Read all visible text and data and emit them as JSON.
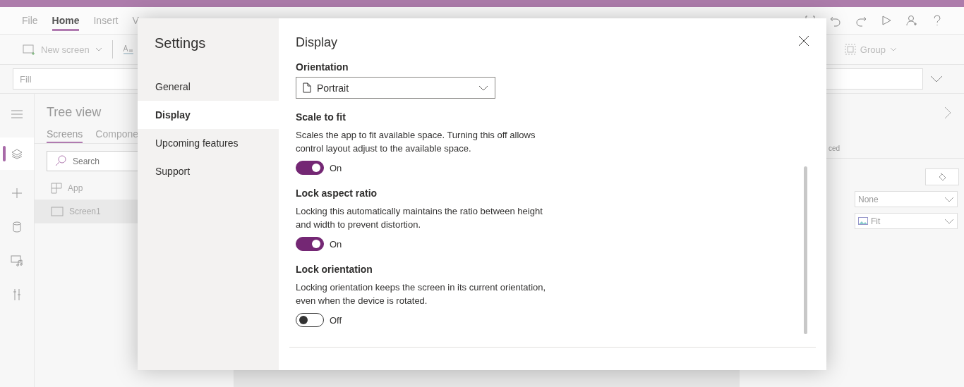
{
  "menu_tabs": [
    {
      "label": "File",
      "selected": false
    },
    {
      "label": "Home",
      "selected": true
    },
    {
      "label": "Insert",
      "selected": false
    },
    {
      "label": "V",
      "selected": false
    }
  ],
  "toolbar": {
    "new_screen": "New screen",
    "group": "Group"
  },
  "formula_bar": {
    "property": "Fill"
  },
  "rail_items": [
    {
      "kind": "menu",
      "selected": false
    },
    {
      "kind": "layers",
      "selected": true
    },
    {
      "kind": "plus",
      "selected": false
    },
    {
      "kind": "database",
      "selected": false
    },
    {
      "kind": "media",
      "selected": false
    },
    {
      "kind": "tools",
      "selected": false
    }
  ],
  "tree_view": {
    "title": "Tree view",
    "tabs": [
      {
        "label": "Screens",
        "selected": true
      },
      {
        "label": "Compone",
        "selected": false
      }
    ],
    "search_placeholder": "Search",
    "items": [
      {
        "label": "App",
        "kind": "app",
        "selected": false
      },
      {
        "label": "Screen1",
        "kind": "screen",
        "selected": true
      }
    ]
  },
  "properties_panel": {
    "tab_fragment": "ced",
    "dropdowns": [
      {
        "value": "None",
        "kind": "plain"
      },
      {
        "value": "Fit",
        "kind": "image"
      }
    ]
  },
  "settings_dialog": {
    "title": "Settings",
    "nav": [
      {
        "label": "General",
        "selected": false
      },
      {
        "label": "Display",
        "selected": true
      },
      {
        "label": "Upcoming features",
        "selected": false
      },
      {
        "label": "Support",
        "selected": false
      }
    ],
    "section_title": "Display",
    "orientation": {
      "label": "Orientation",
      "value": "Portrait"
    },
    "options": [
      {
        "title": "Scale to fit",
        "description": "Scales the app to fit available space. Turning this off allows control layout adjust to the available space.",
        "on": true,
        "state_label": "On"
      },
      {
        "title": "Lock aspect ratio",
        "description": "Locking this automatically maintains the ratio between height and width to prevent distortion.",
        "on": true,
        "state_label": "On"
      },
      {
        "title": "Lock orientation",
        "description": "Locking orientation keeps the screen in its current orientation, even when the device is rotated.",
        "on": false,
        "state_label": "Off"
      }
    ]
  }
}
